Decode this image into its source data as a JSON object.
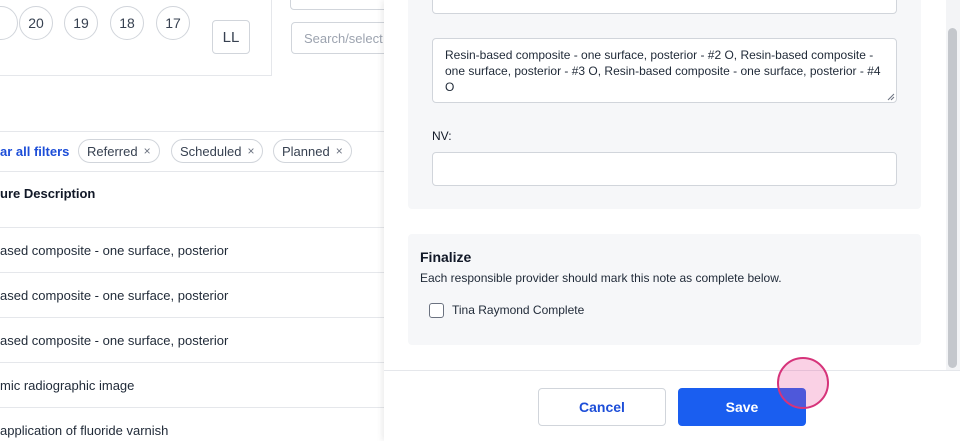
{
  "tooth_chart": {
    "teeth": [
      "20",
      "19",
      "18",
      "17"
    ],
    "ll_label": "LL"
  },
  "search": {
    "placeholder_visible": "Search/select p"
  },
  "filters": {
    "clear_label": "ar all filters",
    "chips": [
      "Referred",
      "Scheduled",
      "Planned"
    ],
    "remove_icon": "×"
  },
  "table": {
    "header": "ure Description",
    "rows": [
      "ased composite - one surface, posterior",
      "ased composite - one surface, posterior",
      "ased composite - one surface, posterior",
      "mic radiographic image",
      "application of fluoride varnish"
    ]
  },
  "drawer": {
    "procedures_text": "Resin-based composite - one surface, posterior - #2 O, Resin-based composite - one surface, posterior - #3 O, Resin-based composite - one surface, posterior - #4 O",
    "nv_label": "NV:",
    "nv_value": "",
    "finalize": {
      "title": "Finalize",
      "description": "Each responsible provider should mark this note as complete below.",
      "provider_checkbox_label": "Tina Raymond Complete",
      "provider_checked": false
    },
    "cancel_label": "Cancel",
    "save_label": "Save"
  },
  "colors": {
    "accent": "#1a5ef0",
    "link": "#1d4ed8",
    "panel_bg": "#f6f7f9",
    "cursor_ring": "#d6337a"
  }
}
